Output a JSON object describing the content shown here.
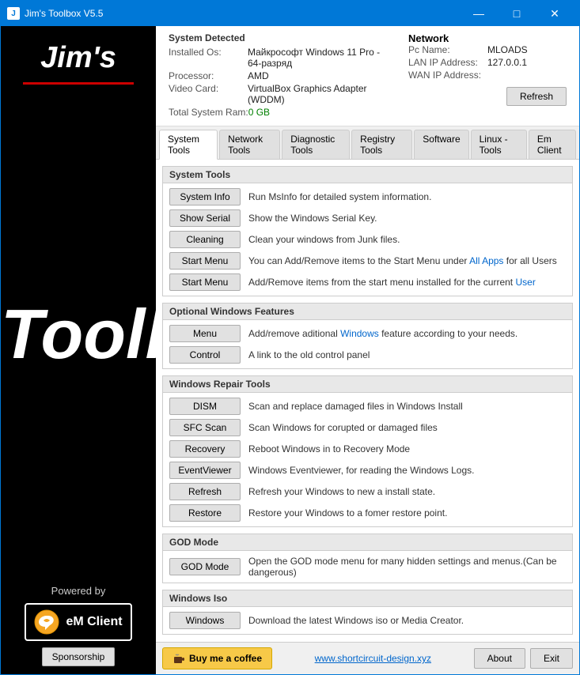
{
  "window": {
    "title": "Jim's Toolbox V5.5"
  },
  "sidebar": {
    "jims": "Jim's",
    "toolbox": "Toolbox",
    "powered_by": "Powered by",
    "emclient_label": "eM Client",
    "sponsorship_label": "Sponsorship"
  },
  "system_info": {
    "title": "System Detected",
    "installed_os_label": "Installed Os:",
    "installed_os_value": "Майкрософт Windows 11 Pro - 64-разряд",
    "processor_label": "Processor:",
    "processor_value": "AMD",
    "video_card_label": "Video Card:",
    "video_card_value": "VirtualBox Graphics Adapter (WDDM)",
    "total_ram_label": "Total System Ram:",
    "total_ram_value": "0 GB"
  },
  "network": {
    "title": "Network",
    "pc_name_label": "Pc Name:",
    "pc_name_value": "MLOADS",
    "lan_ip_label": "LAN IP Address:",
    "lan_ip_value": "127.0.0.1",
    "wan_ip_label": "WAN IP Address:",
    "wan_ip_value": "",
    "refresh_label": "Refresh"
  },
  "tabs": [
    {
      "label": "System Tools",
      "active": true
    },
    {
      "label": "Network Tools",
      "active": false
    },
    {
      "label": "Diagnostic Tools",
      "active": false
    },
    {
      "label": "Registry Tools",
      "active": false
    },
    {
      "label": "Software",
      "active": false
    },
    {
      "label": "Linux - Tools",
      "active": false
    },
    {
      "label": "Em Client",
      "active": false
    }
  ],
  "sections": {
    "system_tools": {
      "header": "System Tools",
      "tools": [
        {
          "btn": "System Info",
          "desc": "Run MsInfo for detailed system information."
        },
        {
          "btn": "Show Serial",
          "desc": "Show the Windows Serial Key."
        },
        {
          "btn": "Cleaning",
          "desc": "Clean your windows from Junk files."
        },
        {
          "btn": "Start Menu",
          "desc": "You can Add/Remove items to the Start Menu under All Apps for all Users"
        },
        {
          "btn": "Start Menu",
          "desc": "Add/Remove items from the start menu installed for the current User"
        }
      ]
    },
    "optional_windows": {
      "header": "Optional Windows Features",
      "tools": [
        {
          "btn": "Menu",
          "desc": "Add/remove aditional Windows feature according to your needs."
        },
        {
          "btn": "Control",
          "desc": "A link to the old control panel"
        }
      ]
    },
    "windows_repair": {
      "header": "Windows Repair Tools",
      "tools": [
        {
          "btn": "DISM",
          "desc": "Scan and replace damaged files in Windows Install"
        },
        {
          "btn": "SFC Scan",
          "desc": "Scan Windows for corupted or damaged files"
        },
        {
          "btn": "Recovery",
          "desc": "Reboot Windows in to Recovery Mode"
        },
        {
          "btn": "EventViewer",
          "desc": "Windows Eventviewer, for reading the Windows Logs."
        },
        {
          "btn": "Refresh",
          "desc": "Refresh your Windows to new a install state."
        },
        {
          "btn": "Restore",
          "desc": "Restore your Windows to a fomer restore point."
        }
      ]
    },
    "god_mode": {
      "header": "GOD Mode",
      "tools": [
        {
          "btn": "GOD Mode",
          "desc": "Open the GOD mode menu for many hidden settings and menus.(Can be dangerous)"
        }
      ]
    },
    "windows_iso": {
      "header": "Windows Iso",
      "tools": [
        {
          "btn": "Windows",
          "desc": "Download the latest Windows iso or Media Creator."
        }
      ]
    }
  },
  "bottom_bar": {
    "coffee_label": "Buy me a coffee",
    "website_label": "www.shortcircuit-design.xyz",
    "about_label": "About",
    "exit_label": "Exit"
  }
}
